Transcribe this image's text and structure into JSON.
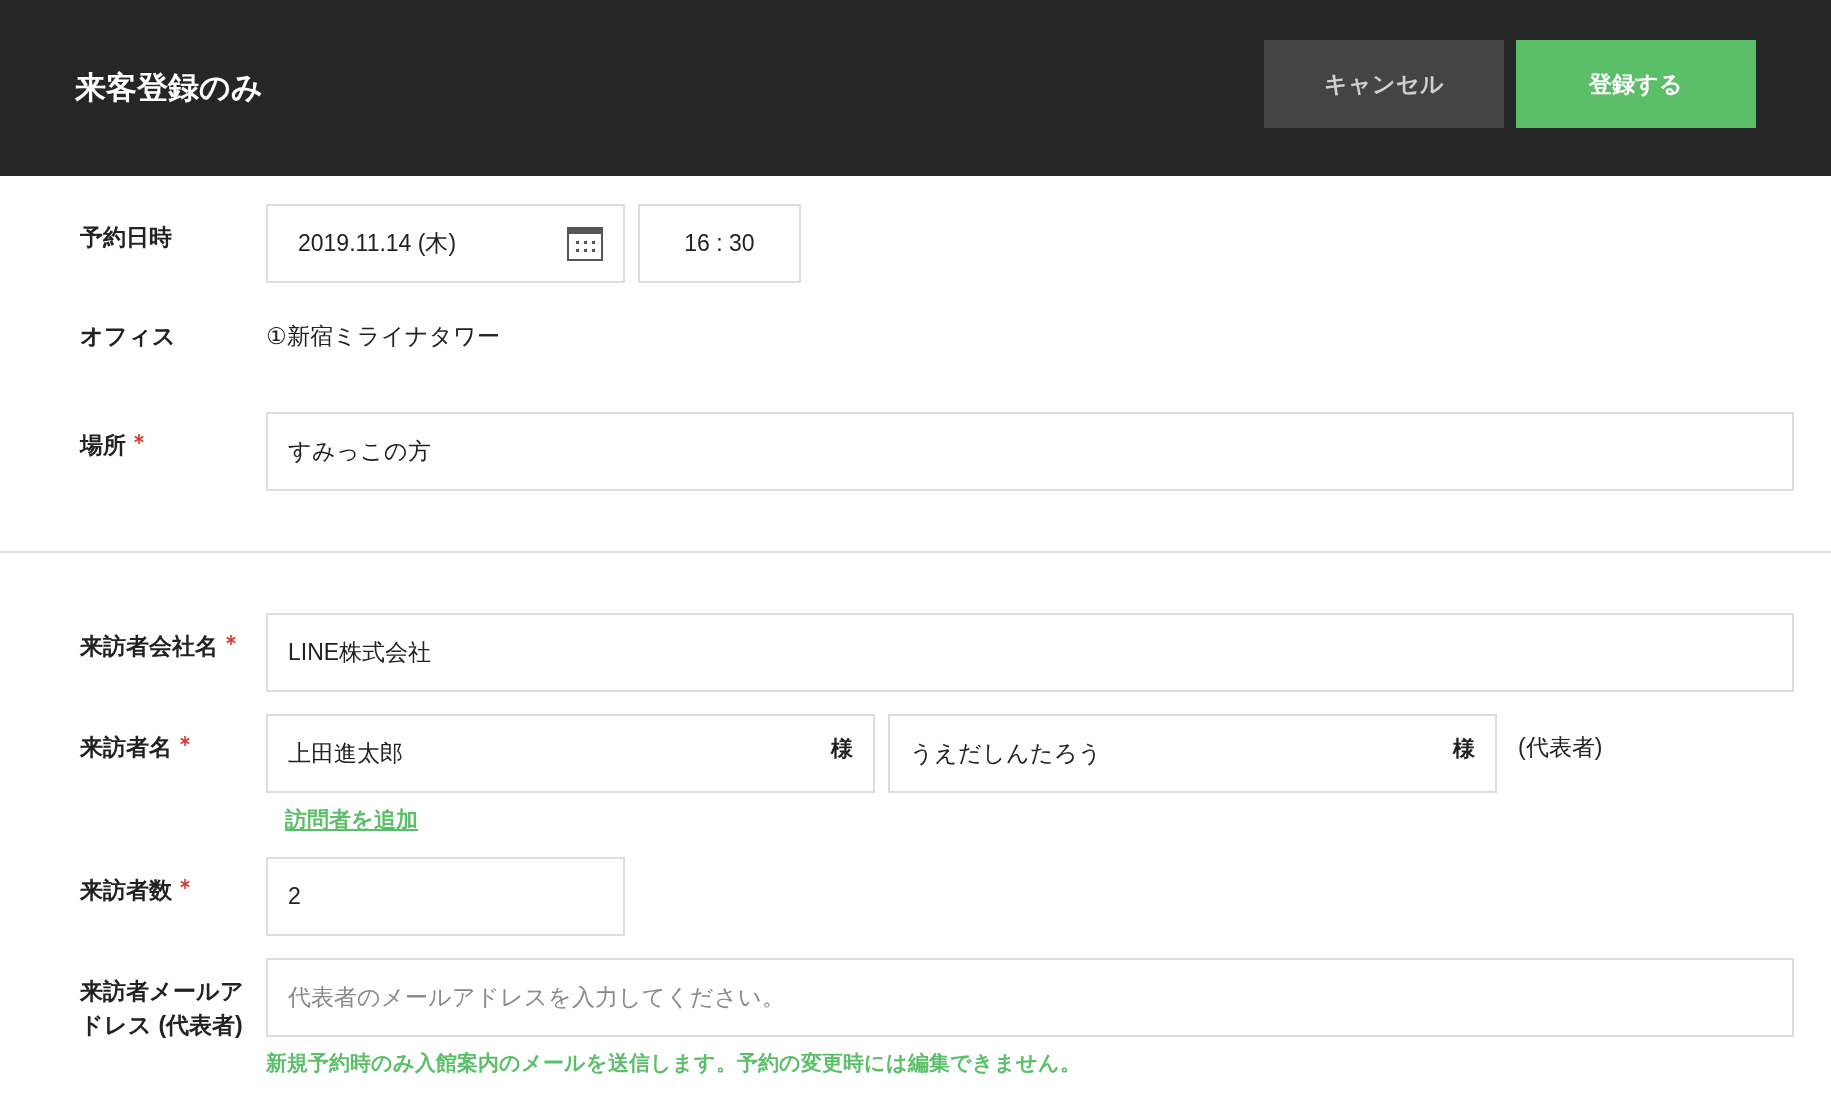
{
  "header": {
    "title": "来客登録のみ",
    "buttons": [
      {
        "label": "キャンセル",
        "kind": "secondary"
      },
      {
        "label": "登録する",
        "kind": "primary"
      }
    ]
  },
  "reservation": {
    "label": "予約日時",
    "required": false,
    "date": "2019.11.14 (木)",
    "time": "16 : 30"
  },
  "office": {
    "label": "オフィス",
    "required": false,
    "value": "①新宿ミライナタワー"
  },
  "location": {
    "label": "場所",
    "required": true,
    "value": "すみっこの方"
  },
  "company": {
    "label": "来訪者会社名",
    "required": true,
    "value": "LINE株式会社"
  },
  "visitor_name": {
    "label": "来訪者名",
    "required": true,
    "name": "上田進太郎",
    "name_suffix": "様",
    "kana": "うえだしんたろう",
    "kana_suffix": "様",
    "note": "(代表者)",
    "add_link": "訪問者を追加"
  },
  "visitor_count": {
    "label": "来訪者数",
    "required": true,
    "value": "2"
  },
  "email": {
    "label": "来訪者メールアドレス (代表者)",
    "required": false,
    "placeholder": "代表者のメールアドレスを入力してください。",
    "hint": "新規予約時のみ入館案内のメールを送信します。予約の変更時には編集できません。"
  }
}
